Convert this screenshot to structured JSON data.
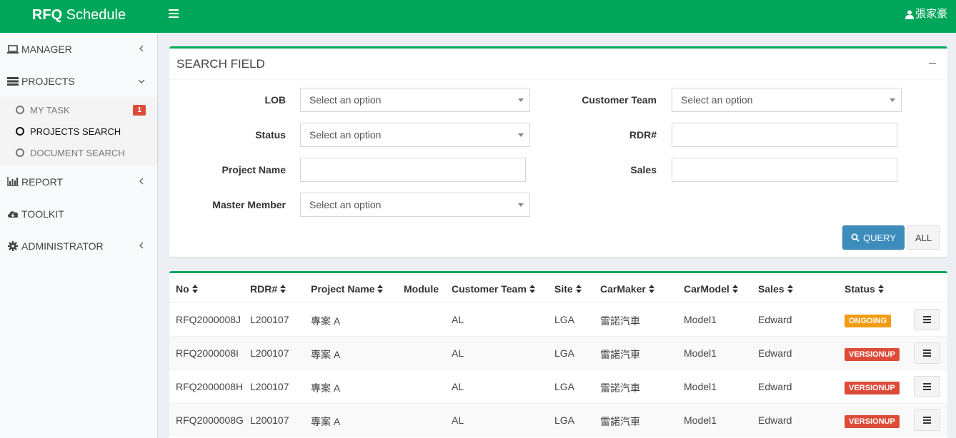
{
  "header": {
    "brand_bold": "RFQ",
    "brand_rest": " Schedule",
    "user_name": "張家豪"
  },
  "sidebar": {
    "items": [
      {
        "label": "MANAGER",
        "icon": "laptop-icon"
      },
      {
        "label": "PROJECTS",
        "icon": "server-icon"
      },
      {
        "label": "REPORT",
        "icon": "bar-chart-icon"
      },
      {
        "label": "TOOLKIT",
        "icon": "cloud-download-icon"
      },
      {
        "label": "ADMINISTRATOR",
        "icon": "gear-icon"
      }
    ],
    "sub_items": [
      {
        "label": "MY TASK",
        "badge": "1"
      },
      {
        "label": "PROJECTS SEARCH"
      },
      {
        "label": "DOCUMENT SEARCH"
      }
    ]
  },
  "search": {
    "title": "SEARCH FIELD",
    "labels": {
      "lob": "LOB",
      "customer_team": "Customer Team",
      "status": "Status",
      "rdr": "RDR#",
      "project_name": "Project Name",
      "sales": "Sales",
      "master_member": "Master Member"
    },
    "select_placeholder": "Select an option",
    "query_label": "QUERY",
    "all_label": "ALL"
  },
  "table": {
    "headers": [
      "No",
      "RDR#",
      "Project Name",
      "Module",
      "Customer Team",
      "Site",
      "CarMaker",
      "CarModel",
      "Sales",
      "Status"
    ],
    "rows": [
      {
        "no": "RFQ2000008J",
        "rdr": "L200107",
        "project": "專案 A",
        "module": "",
        "team": "AL",
        "site": "LGA",
        "carmaker": "雷諾汽車",
        "carmodel": "Model1",
        "sales": "Edward",
        "status": "ONGOING"
      },
      {
        "no": "RFQ2000008I",
        "rdr": "L200107",
        "project": "專案 A",
        "module": "",
        "team": "AL",
        "site": "LGA",
        "carmaker": "雷諾汽車",
        "carmodel": "Model1",
        "sales": "Edward",
        "status": "VERSIONUP"
      },
      {
        "no": "RFQ2000008H",
        "rdr": "L200107",
        "project": "專案 A",
        "module": "",
        "team": "AL",
        "site": "LGA",
        "carmaker": "雷諾汽車",
        "carmodel": "Model1",
        "sales": "Edward",
        "status": "VERSIONUP"
      },
      {
        "no": "RFQ2000008G",
        "rdr": "L200107",
        "project": "專案 A",
        "module": "",
        "team": "AL",
        "site": "LGA",
        "carmaker": "雷諾汽車",
        "carmodel": "Model1",
        "sales": "Edward",
        "status": "VERSIONUP"
      }
    ]
  },
  "colors": {
    "brand": "#00a65a",
    "ongoing": "#f39c12",
    "versionup": "#dd4b39",
    "query": "#3c8dbc"
  }
}
